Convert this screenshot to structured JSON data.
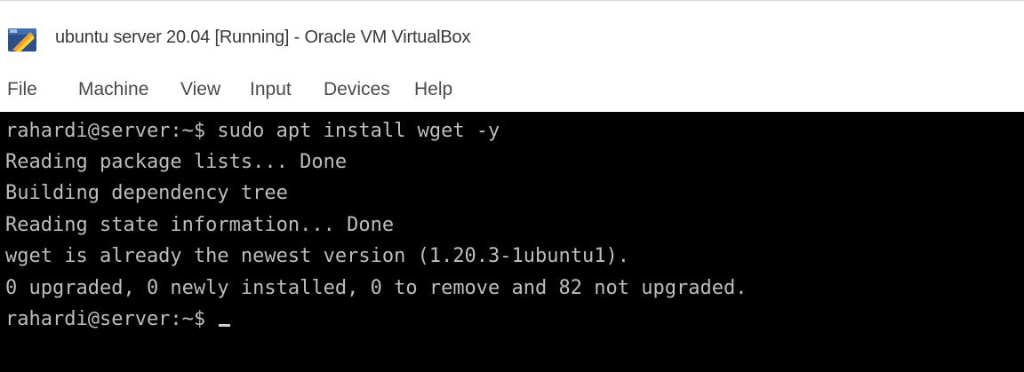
{
  "window": {
    "title": "ubuntu server 20.04 [Running] - Oracle VM VirtualBox",
    "icon": "virtualbox-icon"
  },
  "menu": {
    "items": [
      {
        "label": "File"
      },
      {
        "label": "Machine"
      },
      {
        "label": "View"
      },
      {
        "label": "Input"
      },
      {
        "label": "Devices"
      },
      {
        "label": "Help"
      }
    ]
  },
  "terminal": {
    "lines": [
      "rahardi@server:~$ sudo apt install wget -y",
      "Reading package lists... Done",
      "Building dependency tree",
      "Reading state information... Done",
      "wget is already the newest version (1.20.3-1ubuntu1).",
      "0 upgraded, 0 newly installed, 0 to remove and 82 not upgraded.",
      "rahardi@server:~$ "
    ]
  },
  "colors": {
    "terminal_bg": "#000000",
    "terminal_fg": "#bdbdbd",
    "menu_text": "#4a4a4a",
    "title_text": "#3a3a3a"
  }
}
